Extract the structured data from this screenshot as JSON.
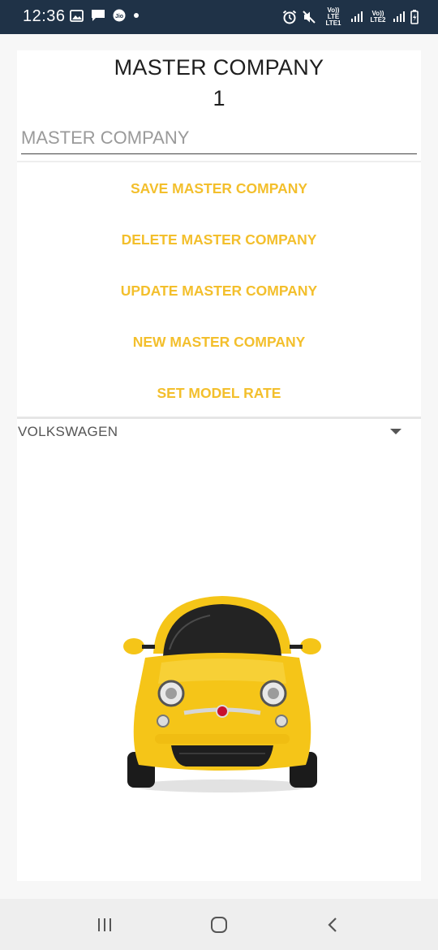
{
  "status_bar": {
    "time": "12:36",
    "left_icons": [
      "gallery-icon",
      "message-icon",
      "jio-icon",
      "dot-icon"
    ],
    "right_icons": [
      "alarm-icon",
      "mute-icon",
      "volte-lte1-icon",
      "signal-icon",
      "volte-lte2-icon",
      "signal-icon",
      "battery-icon"
    ],
    "sim1_label": "Vo)) LTE",
    "sim1_sub": "LTE1",
    "sim2_label": "Vo))",
    "sim2_sub": "LTE2",
    "bar_color": "#1f3247"
  },
  "header": {
    "title": "MASTER COMPANY",
    "id_value": "1"
  },
  "company_input": {
    "value": "",
    "placeholder": "MASTER COMPANY"
  },
  "actions": {
    "color": "#f3bf2c",
    "save_label": "SAVE MASTER COMPANY",
    "delete_label": "DELETE MASTER COMPANY",
    "update_label": "UPDATE MASTER COMPANY",
    "new_label": "NEW MASTER COMPANY",
    "rate_label": "SET MODEL RATE"
  },
  "company_spinner": {
    "selected": "VOLKSWAGEN",
    "icon": "dropdown-arrow-icon"
  },
  "car_image": {
    "icon": "car-image",
    "body_color": "#f5c518"
  },
  "nav_bar": {
    "icons": [
      "recent-apps-icon",
      "home-icon",
      "back-icon"
    ]
  }
}
